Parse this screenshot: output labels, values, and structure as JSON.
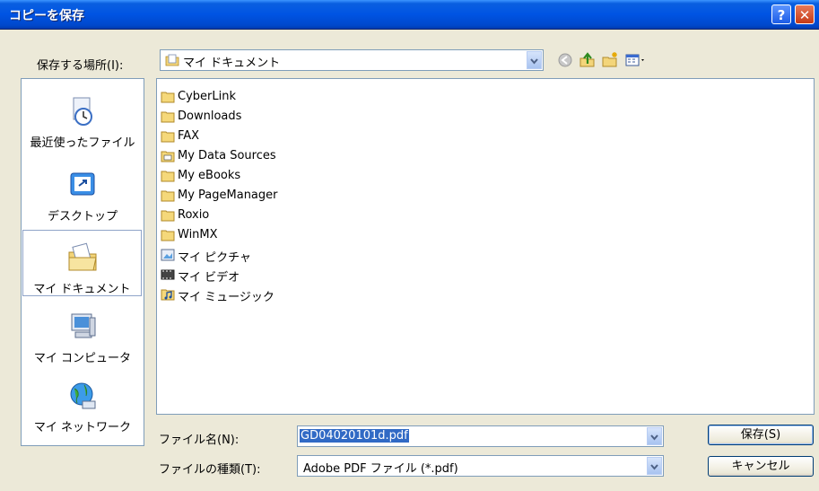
{
  "window": {
    "title": "コピーを保存",
    "help_glyph": "?",
    "close_glyph": "✕"
  },
  "save_in": {
    "label": "保存する場所(I):",
    "value": "マイ ドキュメント"
  },
  "places": [
    {
      "label": "最近使ったファイル",
      "icon": "recent-documents-icon"
    },
    {
      "label": "デスクトップ",
      "icon": "desktop-icon"
    },
    {
      "label": "マイ ドキュメント",
      "icon": "my-documents-icon",
      "selected": true
    },
    {
      "label": "マイ コンピュータ",
      "icon": "my-computer-icon"
    },
    {
      "label": "マイ ネットワーク",
      "icon": "my-network-icon"
    }
  ],
  "files": [
    {
      "name": "CyberLink",
      "icon": "folder-icon"
    },
    {
      "name": "Downloads",
      "icon": "folder-icon"
    },
    {
      "name": "FAX",
      "icon": "folder-icon"
    },
    {
      "name": "My Data Sources",
      "icon": "data-sources-folder-icon"
    },
    {
      "name": "My eBooks",
      "icon": "folder-icon"
    },
    {
      "name": "My PageManager",
      "icon": "folder-icon"
    },
    {
      "name": "Roxio",
      "icon": "folder-icon"
    },
    {
      "name": "WinMX",
      "icon": "folder-icon"
    },
    {
      "name": "マイ ピクチャ",
      "icon": "my-pictures-folder-icon"
    },
    {
      "name": "マイ ビデオ",
      "icon": "my-videos-folder-icon"
    },
    {
      "name": "マイ ミュージック",
      "icon": "my-music-folder-icon"
    }
  ],
  "filename": {
    "label": "ファイル名(N):",
    "value": "GD04020101d.pdf"
  },
  "filetype": {
    "label": "ファイルの種類(T):",
    "value": "Adobe PDF ファイル (*.pdf)"
  },
  "buttons": {
    "save": "保存(S)",
    "cancel": "キャンセル"
  },
  "colors": {
    "titlebar": "#0054e3",
    "selection": "#316ac5",
    "folder": "#f5d87a"
  }
}
